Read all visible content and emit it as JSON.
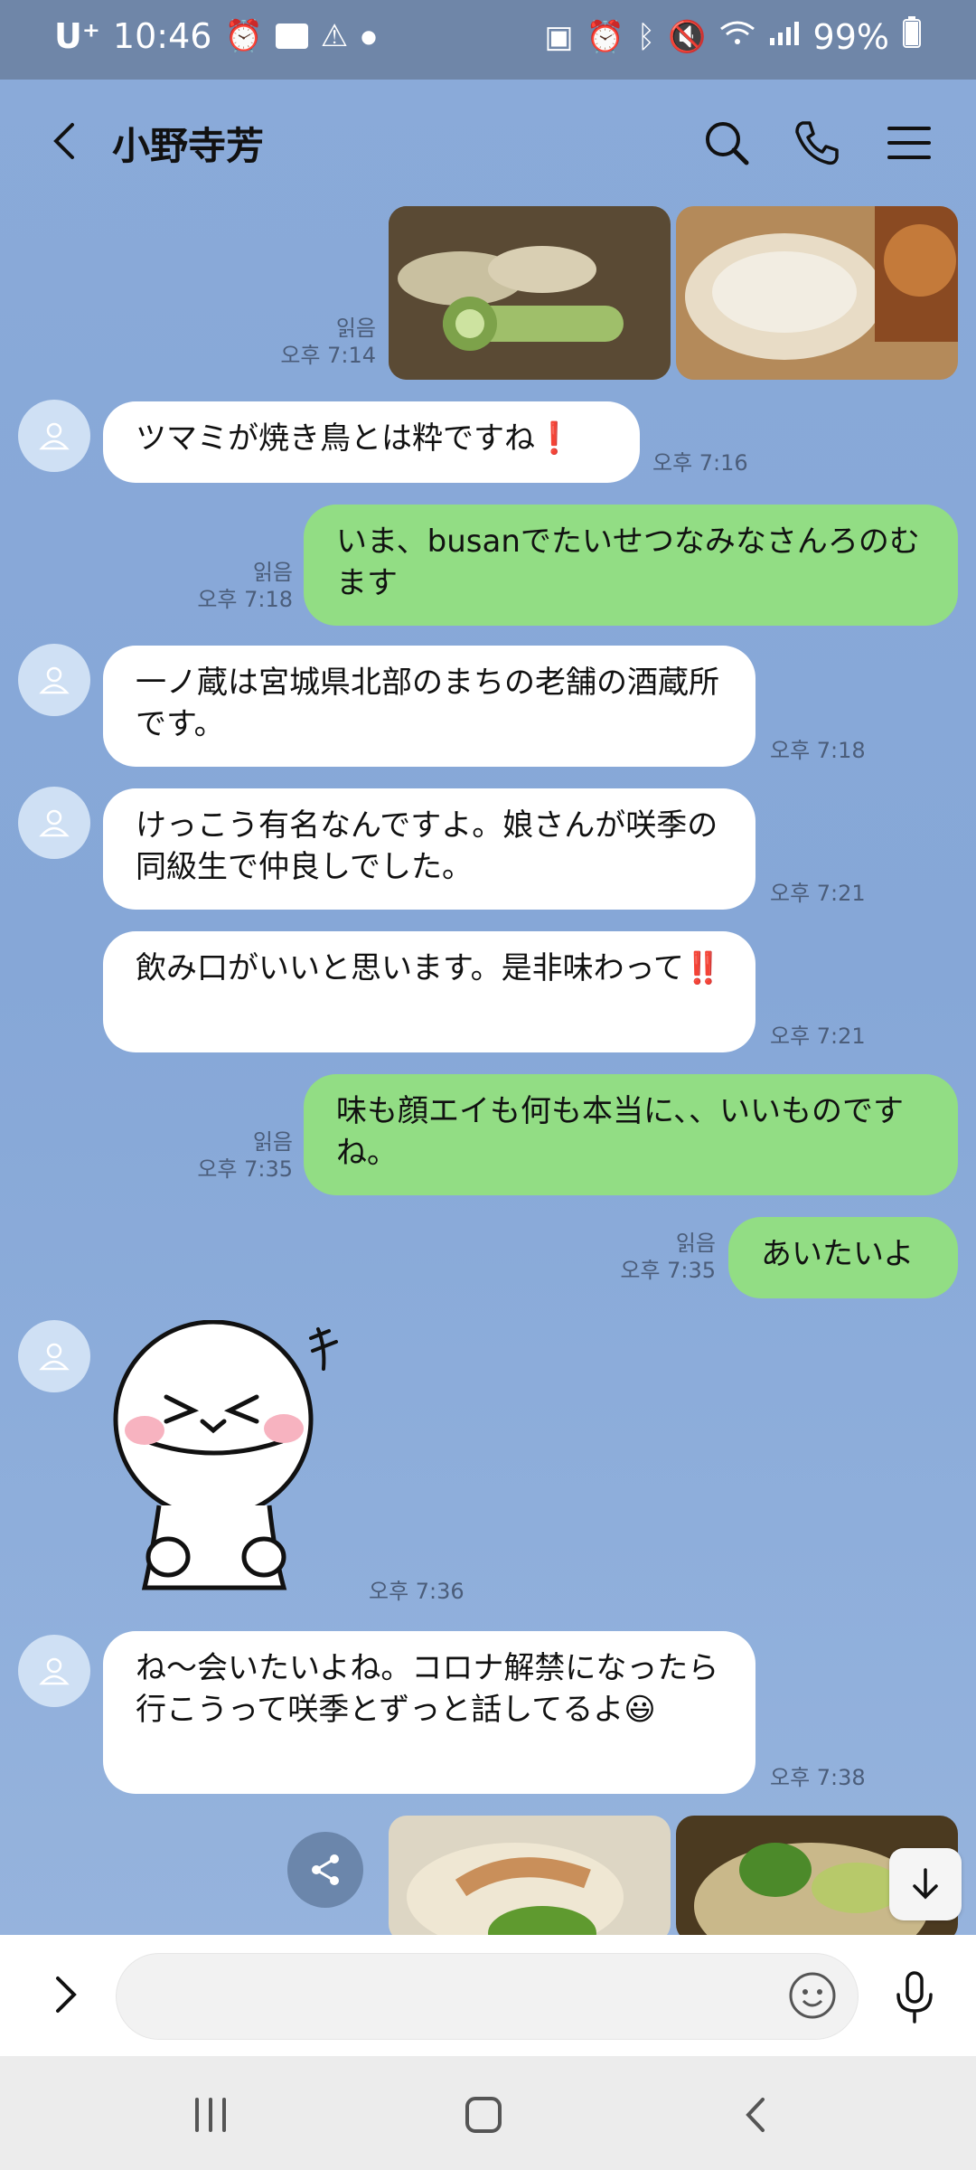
{
  "status": {
    "carrier": "U⁺",
    "time": "10:46",
    "battery": "99%",
    "left_icons": [
      "alarm-icon",
      "cgv-icon",
      "warning-icon",
      "dot-icon"
    ],
    "right_icons": [
      "battery-saver-icon",
      "alarm-icon",
      "bluetooth-icon",
      "mute-icon",
      "wifi-icon",
      "signal-icon",
      "battery-icon"
    ]
  },
  "header": {
    "title": "小野寺芳"
  },
  "messages": {
    "m0": {
      "read": "읽음",
      "time": "오후 7:14"
    },
    "m1": {
      "text": "ツマミが焼き鳥とは粋ですね❗",
      "time": "오후 7:16"
    },
    "m2": {
      "text": "いま、busanでたいせつなみなさんろのむます",
      "read": "읽음",
      "time": "오후 7:18"
    },
    "m3": {
      "text": "一ノ蔵は宮城県北部のまちの老舗の酒蔵所です。",
      "time": "오후 7:18"
    },
    "m4": {
      "text": "けっこう有名なんですよ。娘さんが咲季の同級生で仲良しでした。",
      "time": "오후 7:21"
    },
    "m5": {
      "text": "飲み口がいいと思います。是非味わって‼️",
      "time": "오후 7:21"
    },
    "m6": {
      "text": "味も顔エイも何も本当に、、いいものですね。",
      "read": "읽음",
      "time": "오후 7:35"
    },
    "m7": {
      "text": "あいたいよ",
      "read": "읽음",
      "time": "오후 7:35"
    },
    "m8": {
      "sticker": "smiling-character-sticker",
      "time": "오후 7:36"
    },
    "m9": {
      "text": "ね〜会いたいよね。コロナ解禁になったら行こうって咲季とずっと話してるよ😃",
      "time": "오후 7:38"
    }
  },
  "input": {
    "placeholder": ""
  },
  "colors": {
    "chat_bg": "#8aaad9",
    "outgoing": "#92dd84",
    "incoming": "#ffffff",
    "status_bar": "#6f86a8"
  }
}
